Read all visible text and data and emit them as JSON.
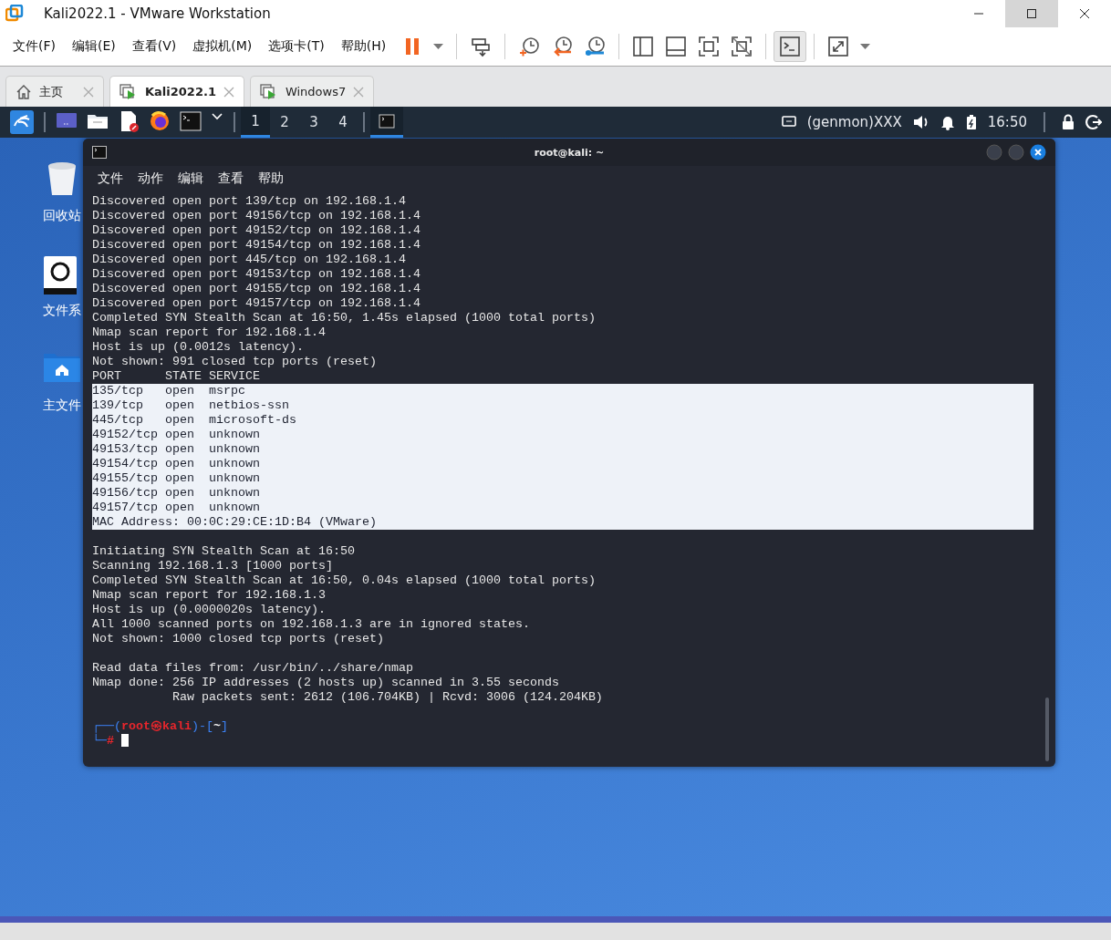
{
  "window": {
    "title": "Kali2022.1 - VMware Workstation"
  },
  "menu": [
    "文件(F)",
    "编辑(E)",
    "查看(V)",
    "虚拟机(M)",
    "选项卡(T)",
    "帮助(H)"
  ],
  "toolbar": [
    {
      "kind": "pause",
      "pressed": false
    },
    {
      "kind": "caret",
      "pressed": false
    },
    {
      "kind": "sep"
    },
    {
      "kind": "send-keys",
      "pressed": false
    },
    {
      "kind": "sep"
    },
    {
      "kind": "snapshot",
      "pressed": false
    },
    {
      "kind": "revert",
      "pressed": false
    },
    {
      "kind": "manage",
      "pressed": false
    },
    {
      "kind": "sep"
    },
    {
      "kind": "library",
      "pressed": false
    },
    {
      "kind": "thumbs",
      "pressed": false
    },
    {
      "kind": "fullscreen",
      "pressed": false
    },
    {
      "kind": "unity",
      "pressed": false
    },
    {
      "kind": "sep"
    },
    {
      "kind": "console",
      "pressed": true
    },
    {
      "kind": "sep"
    },
    {
      "kind": "stretch",
      "pressed": false
    },
    {
      "kind": "caret",
      "pressed": false
    }
  ],
  "tabs": [
    {
      "label": "主页",
      "kind": "home",
      "selected": false
    },
    {
      "label": "Kali2022.1",
      "kind": "vm",
      "selected": true
    },
    {
      "label": "Windows7",
      "kind": "vm",
      "selected": false
    }
  ],
  "panel": {
    "launchers": [
      {
        "kind": "menu"
      },
      {
        "kind": "desktop"
      },
      {
        "kind": "files"
      },
      {
        "kind": "editor"
      },
      {
        "kind": "browser"
      },
      {
        "kind": "terminal"
      },
      {
        "kind": "caret"
      }
    ],
    "workspaces": [
      {
        "label": "1",
        "selected": true
      },
      {
        "label": "2",
        "selected": false
      },
      {
        "label": "3",
        "selected": false
      },
      {
        "label": "4",
        "selected": false
      }
    ],
    "tasks": [
      {
        "kind": "terminal",
        "selected": true
      }
    ],
    "genmon": "(genmon)XXX",
    "clock": "16:50"
  },
  "desktop_icons": [
    {
      "label": "回收站",
      "kind": "trash"
    },
    {
      "label": "文件系",
      "kind": "drive"
    },
    {
      "label": "主文件",
      "kind": "home"
    }
  ],
  "terminal": {
    "title": "root@kali: ~",
    "menu": [
      "文件",
      "动作",
      "编辑",
      "查看",
      "帮助"
    ],
    "blocks": [
      [
        {
          "text": "Discovered open port 139/tcp on 192.168.1.4",
          "selected": false
        },
        {
          "text": "Discovered open port 49156/tcp on 192.168.1.4",
          "selected": false
        },
        {
          "text": "Discovered open port 49152/tcp on 192.168.1.4",
          "selected": false
        },
        {
          "text": "Discovered open port 49154/tcp on 192.168.1.4",
          "selected": false
        },
        {
          "text": "Discovered open port 445/tcp on 192.168.1.4",
          "selected": false
        },
        {
          "text": "Discovered open port 49153/tcp on 192.168.1.4",
          "selected": false
        },
        {
          "text": "Discovered open port 49155/tcp on 192.168.1.4",
          "selected": false
        },
        {
          "text": "Discovered open port 49157/tcp on 192.168.1.4",
          "selected": false
        },
        {
          "text": "Completed SYN Stealth Scan at 16:50, 1.45s elapsed (1000 total ports)",
          "selected": false
        },
        {
          "text": "Nmap scan report for 192.168.1.4",
          "selected": false
        },
        {
          "text": "Host is up (0.0012s latency).",
          "selected": false
        },
        {
          "text": "Not shown: 991 closed tcp ports (reset)",
          "selected": false
        },
        {
          "text": "PORT      STATE SERVICE",
          "selected": false
        },
        {
          "text": "135/tcp   open  msrpc",
          "selected": true
        },
        {
          "text": "139/tcp   open  netbios-ssn",
          "selected": true
        },
        {
          "text": "445/tcp   open  microsoft-ds",
          "selected": true
        },
        {
          "text": "49152/tcp open  unknown",
          "selected": true
        },
        {
          "text": "49153/tcp open  unknown",
          "selected": true
        },
        {
          "text": "49154/tcp open  unknown",
          "selected": true
        },
        {
          "text": "49155/tcp open  unknown",
          "selected": true
        },
        {
          "text": "49156/tcp open  unknown",
          "selected": true
        },
        {
          "text": "49157/tcp open  unknown",
          "selected": true
        },
        {
          "text": "MAC Address: 00:0C:29:CE:1D:B4 (VMware)",
          "selected": true
        }
      ],
      [
        {
          "text": "Initiating SYN Stealth Scan at 16:50",
          "selected": false
        },
        {
          "text": "Scanning 192.168.1.3 [1000 ports]",
          "selected": false
        },
        {
          "text": "Completed SYN Stealth Scan at 16:50, 0.04s elapsed (1000 total ports)",
          "selected": false
        },
        {
          "text": "Nmap scan report for 192.168.1.3",
          "selected": false
        },
        {
          "text": "Host is up (0.0000020s latency).",
          "selected": false
        },
        {
          "text": "All 1000 scanned ports on 192.168.1.3 are in ignored states.",
          "selected": false
        },
        {
          "text": "Not shown: 1000 closed tcp ports (reset)",
          "selected": false
        }
      ],
      [
        {
          "text": "Read data files from: /usr/bin/../share/nmap",
          "selected": false
        },
        {
          "text": "Nmap done: 256 IP addresses (2 hosts up) scanned in 3.55 seconds",
          "selected": false
        },
        {
          "text": "           Raw packets sent: 2612 (106.704KB) | Rcvd: 3006 (124.204KB)",
          "selected": false
        }
      ]
    ],
    "prompt": [
      [
        {
          "text": "┌──(",
          "kind": "frame"
        },
        {
          "text": "root㉿kali",
          "kind": "user"
        },
        {
          "text": ")-[",
          "kind": "frame"
        },
        {
          "text": "~",
          "kind": "dir"
        },
        {
          "text": "]",
          "kind": "frame"
        }
      ],
      [
        {
          "text": "└─",
          "kind": "frame"
        },
        {
          "text": "#",
          "kind": "user"
        }
      ]
    ]
  }
}
